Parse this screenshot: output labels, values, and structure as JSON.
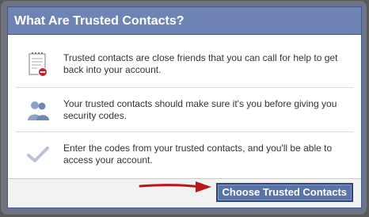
{
  "dialog": {
    "title": "What Are Trusted Contacts?",
    "items": [
      {
        "icon": "document-stop-icon",
        "text": "Trusted contacts are close friends that you can call for help to get back into your account."
      },
      {
        "icon": "people-icon",
        "text": "Your trusted contacts should make sure it's you before giving you security codes."
      },
      {
        "icon": "checkmark-icon",
        "text": "Enter the codes from your trusted contacts, and you'll be able to access your account."
      }
    ],
    "confirm_button_label": "Choose Trusted Contacts"
  },
  "colors": {
    "header_bg": "#6d84b4",
    "button_bg": "#5b74a8",
    "arrow": "#c0141c"
  }
}
